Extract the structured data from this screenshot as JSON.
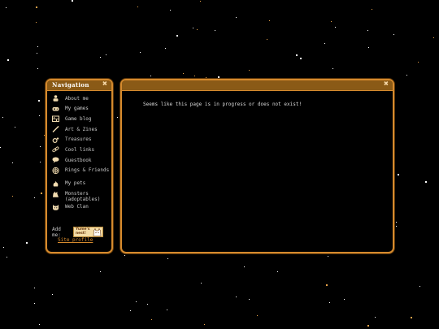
{
  "navigation": {
    "title": "Navigation",
    "items": [
      {
        "label": "About me",
        "icon": "person-icon"
      },
      {
        "label": "My games",
        "icon": "gamepad-icon"
      },
      {
        "label": "Game blog",
        "icon": "bookshelf-icon"
      },
      {
        "label": "Art & Zines",
        "icon": "pencil-icon"
      },
      {
        "label": "Treasures",
        "icon": "ring-icon"
      },
      {
        "label": "Cool links",
        "icon": "link-icon"
      },
      {
        "label": "Guestbook",
        "icon": "speech-bubble-icon"
      },
      {
        "label": "Rings & Friends",
        "icon": "web-ring-icon"
      },
      {
        "label": "My pets",
        "icon": "pet-icon"
      },
      {
        "label": "Monsters (adoptables)",
        "icon": "monster-icon"
      },
      {
        "label": "Web Clan",
        "icon": "cat-face-icon"
      }
    ],
    "add_me_label": "Add me:",
    "badge_text": "Yume's nest!",
    "site_profile_label": "Site profile"
  },
  "content": {
    "message": "Seems like this page is in progress or does not exist!"
  },
  "colors": {
    "background": "#000000",
    "accent": "#d58a2e",
    "titlebar": "#8a5a16",
    "icon": "#f2dcb0"
  }
}
